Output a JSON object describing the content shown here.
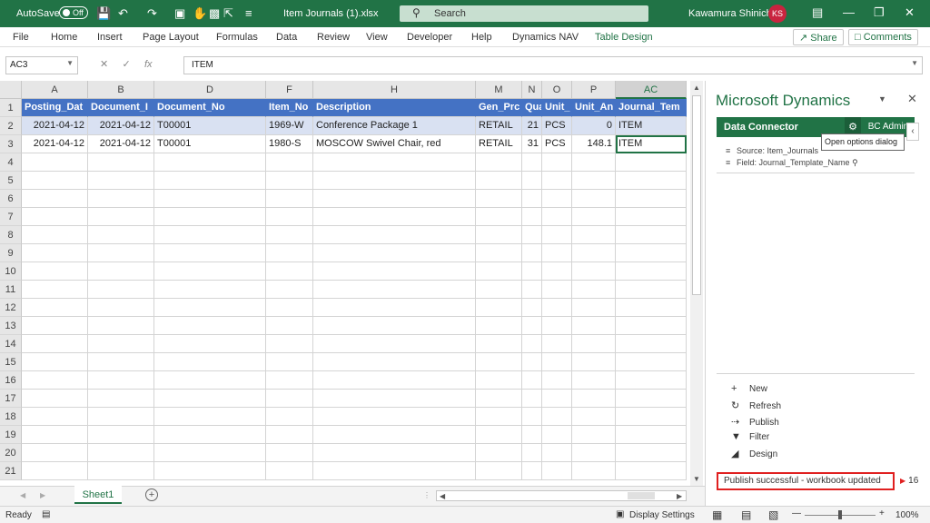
{
  "titlebar": {
    "autosave_label": "AutoSave",
    "autosave_state": "Off",
    "document_title": "Item Journals (1).xlsx",
    "search_placeholder": "Search",
    "user_name": "Kawamura Shinichi",
    "user_initials": "KS"
  },
  "ribbon": {
    "tabs": [
      "File",
      "Home",
      "Insert",
      "Page Layout",
      "Formulas",
      "Data",
      "Review",
      "View",
      "Developer",
      "Help",
      "Dynamics NAV",
      "Table Design"
    ],
    "share_label": "Share",
    "comments_label": "Comments"
  },
  "formula_bar": {
    "name_box": "AC3",
    "fx_label": "fx",
    "formula_value": "ITEM"
  },
  "sheet": {
    "columns": [
      "A",
      "B",
      "D",
      "F",
      "H",
      "M",
      "N",
      "O",
      "P",
      "AC"
    ],
    "selected_column": "AC",
    "header_row": [
      "Posting_Dat",
      "Document_I",
      "Document_No",
      "Item_No",
      "Description",
      "Gen_Prc",
      "Qua",
      "Unit_",
      "Unit_An",
      "Journal_Tem"
    ],
    "rows": [
      [
        "2021-04-12",
        "2021-04-12",
        "T00001",
        "1969-W",
        "Conference Package 1",
        "RETAIL",
        "21",
        "PCS",
        "0",
        "ITEM"
      ],
      [
        "2021-04-12",
        "2021-04-12",
        "T00001",
        "1980-S",
        "MOSCOW Swivel Chair, red",
        "RETAIL",
        "31",
        "PCS",
        "148.1",
        "ITEM"
      ]
    ],
    "row_numbers": [
      "1",
      "2",
      "3",
      "4",
      "5",
      "6",
      "7",
      "8",
      "9",
      "10",
      "11",
      "12",
      "13",
      "14",
      "15",
      "16",
      "17",
      "18",
      "19",
      "20",
      "21"
    ],
    "sheet_tab": "Sheet1"
  },
  "statusbar": {
    "ready": "Ready",
    "display_settings": "Display Settings",
    "zoom": "100%"
  },
  "pane": {
    "title": "Microsoft Dynamics",
    "connector_title": "Data Connector",
    "user_label": "BC Admin",
    "tooltip": "Open options dialog",
    "source": "Source: Item_Journals",
    "field": "Field: Journal_Template_Name",
    "actions": [
      {
        "label": "New",
        "icon": "plus-icon"
      },
      {
        "label": "Refresh",
        "icon": "refresh-icon"
      },
      {
        "label": "Publish",
        "icon": "publish-icon"
      },
      {
        "label": "Filter",
        "icon": "filter-icon"
      },
      {
        "label": "Design",
        "icon": "design-icon"
      }
    ],
    "status_message": "Publish successful - workbook updated",
    "status_count": "16"
  },
  "colors": {
    "excel_green": "#217346",
    "table_header_blue": "#4472c4",
    "band_blue": "#d9e1f2",
    "status_border_red": "#e02020"
  }
}
